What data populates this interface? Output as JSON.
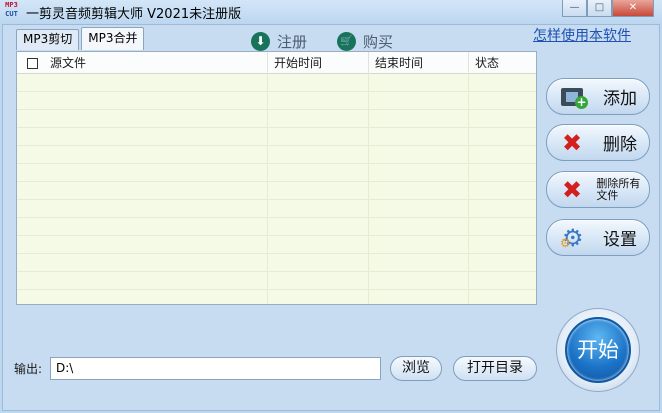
{
  "window": {
    "icon_top": "MP3",
    "icon_bottom": "CUT",
    "title": "一剪灵音频剪辑大师 V2021未注册版",
    "minimize": "—",
    "maximize": "□",
    "close": "✕"
  },
  "tabs": [
    {
      "label": "MP3剪切"
    },
    {
      "label": "MP3合并",
      "active": true
    }
  ],
  "toplinks": {
    "register": {
      "label": "注册",
      "icon": "download-arrow-icon",
      "glyph": "⬇"
    },
    "buy": {
      "label": "购买",
      "icon": "shopping-cart-icon",
      "glyph": "🛒"
    }
  },
  "howto_link": "怎样使用本软件",
  "table": {
    "columns": [
      "源文件",
      "开始时间",
      "结束时间",
      "状态"
    ],
    "rows": []
  },
  "side_buttons": {
    "add": {
      "label": "添加",
      "icon": "film-add-icon"
    },
    "delete": {
      "label": "删除",
      "icon": "red-x-icon"
    },
    "delete_all": {
      "label": "删除所有文件",
      "icon": "red-x-icon"
    },
    "settings": {
      "label": "设置",
      "icon": "gear-icon"
    }
  },
  "start_button": "开始",
  "output": {
    "label": "输出:",
    "path": "D:\\"
  },
  "browse_button": "浏览",
  "open_dir_button": "打开目录",
  "colors": {
    "background": "#c7dcf1",
    "table_bg": "#f5fae6",
    "accent_blue": "#1c74c8",
    "delete_red": "#d3201f",
    "link_blue": "#1f52b3"
  }
}
